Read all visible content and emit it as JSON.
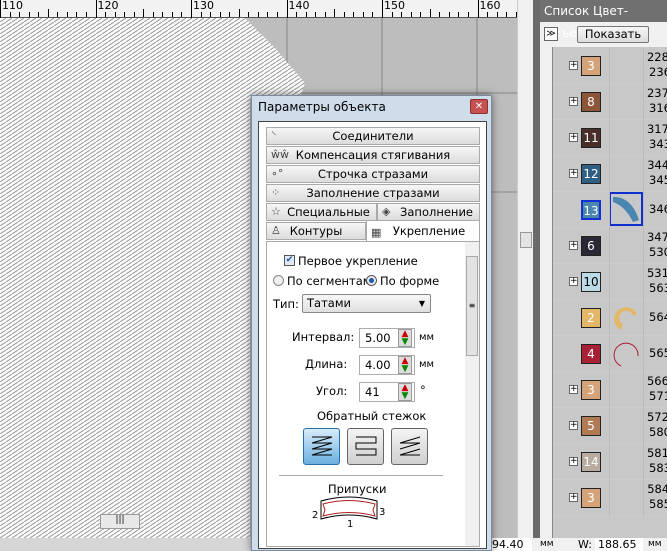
{
  "ruler": {
    "labels": [
      "110",
      "120",
      "130",
      "140",
      "150",
      "160"
    ]
  },
  "panel": {
    "title": "Список Цвет-Объект",
    "show_button": "Показать",
    "rows": [
      {
        "color_num": "3",
        "color": "#d4a37a",
        "range": "228-\n236",
        "expand": true
      },
      {
        "color_num": "8",
        "color": "#8a5538",
        "range": "237-\n316",
        "expand": true
      },
      {
        "color_num": "11",
        "color": "#4a2e2a",
        "range": "317-\n343",
        "expand": true
      },
      {
        "color_num": "12",
        "color": "#2f5f82",
        "range": "344,\n345",
        "expand": true
      },
      {
        "color_num": "13",
        "color": "#4a86b0",
        "range": "346",
        "expand": false,
        "selected": true
      },
      {
        "color_num": "6",
        "color": "#2a2834",
        "range": "347-\n530",
        "expand": true
      },
      {
        "color_num": "10",
        "color": "#bcdbe6",
        "range": "531-\n563",
        "expand": true,
        "dark_text": true
      },
      {
        "color_num": "2",
        "color": "#e2b868",
        "range": "564",
        "expand": false
      },
      {
        "color_num": "4",
        "color": "#a82035",
        "range": "565",
        "expand": false
      },
      {
        "color_num": "3",
        "color": "#d4a37a",
        "range": "566-\n571",
        "expand": true
      },
      {
        "color_num": "5",
        "color": "#b07a55",
        "range": "572-\n580",
        "expand": true
      },
      {
        "color_num": "14",
        "color": "#b8aca0",
        "range": "581-\n583",
        "expand": true
      },
      {
        "color_num": "3",
        "color": "#d4a37a",
        "range": "584,\n585",
        "expand": true
      }
    ]
  },
  "status": {
    "x_value": "94.40",
    "x_unit": "мм",
    "w_label": "W:",
    "w_value": "188.65",
    "w_unit": "мм"
  },
  "dialog": {
    "title": "Параметры объекта",
    "tabs": {
      "connectors": "Соединители",
      "pull_comp": "Компенсация стягивания",
      "rhinestone_line": "Строчка стразами",
      "rhinestone_fill": "Заполнение стразами",
      "special": "Специальные",
      "fill": "Заполнение",
      "contours": "Контуры",
      "underlay": "Укрепление"
    },
    "first_underlay": "Первое укрепление",
    "by_segments": "По сегментам",
    "by_shape": "По форме",
    "type_label": "Тип:",
    "type_value": "Татами",
    "interval_label": "Интервал:",
    "interval_value": "5.00",
    "interval_unit": "мм",
    "length_label": "Длина:",
    "length_value": "4.00",
    "length_unit": "мм",
    "angle_label": "Угол:",
    "angle_value": "41",
    "angle_unit": "°",
    "backstitch_label": "Обратный стежок",
    "allowances_label": "Припуски",
    "allowance_nums": [
      "1",
      "2",
      "3"
    ]
  }
}
